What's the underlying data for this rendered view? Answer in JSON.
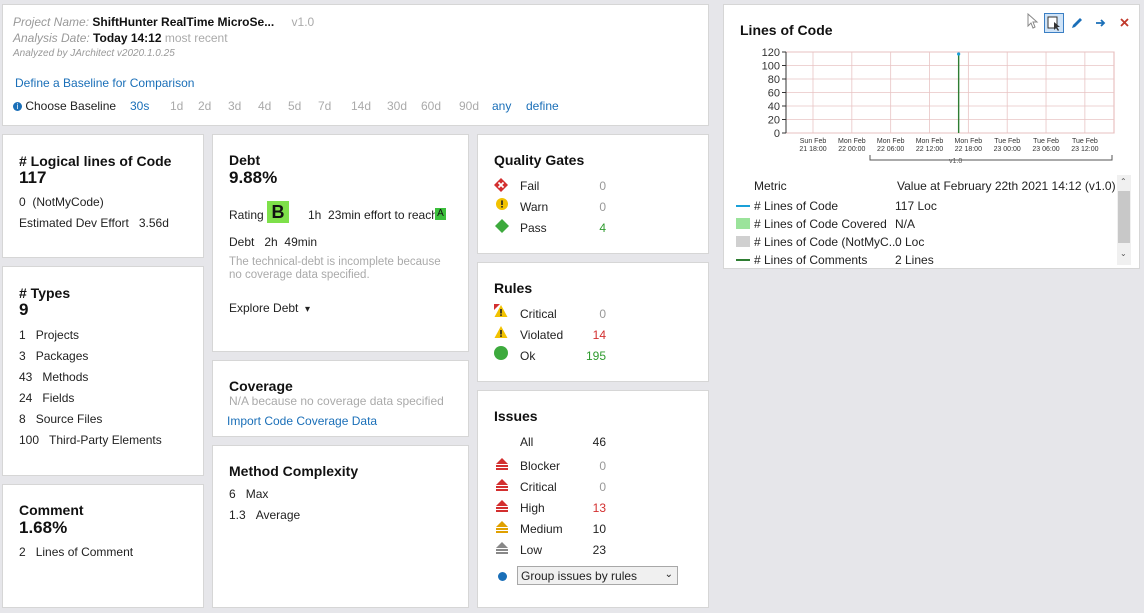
{
  "header": {
    "project_label": "Project Name:",
    "project_name": "ShiftHunter RealTime MicroSe...",
    "version": "v1.0",
    "analysis_label": "Analysis Date:",
    "analysis_date": "Today 14:12",
    "analysis_note": "most recent",
    "analyzed_by": "Analyzed by JArchitect v2020.1.0.25",
    "baseline_link": "Define a Baseline for Comparison",
    "choose_label": "Choose Baseline",
    "baseline_options": [
      "30s",
      "1d",
      "2d",
      "3d",
      "4d",
      "5d",
      "7d",
      "14d",
      "30d",
      "60d",
      "90d",
      "any",
      "define"
    ]
  },
  "loc": {
    "title": "# Logical lines of Code",
    "value": "117",
    "notmycode_num": "0",
    "notmycode_label": "(NotMyCode)",
    "effort_label": "Estimated Dev Effort",
    "effort_value": "3.56d"
  },
  "types": {
    "title": "# Types",
    "value": "9",
    "items": [
      {
        "n": "1",
        "label": "Projects"
      },
      {
        "n": "3",
        "label": "Packages"
      },
      {
        "n": "43",
        "label": "Methods"
      },
      {
        "n": "24",
        "label": "Fields"
      },
      {
        "n": "8",
        "label": "Source Files"
      },
      {
        "n": "100",
        "label": "Third-Party Elements"
      }
    ]
  },
  "comment": {
    "title": "Comment",
    "value": "1.68%",
    "lines_num": "2",
    "lines_label": "Lines of Comment"
  },
  "debt": {
    "title": "Debt",
    "value": "9.88%",
    "rating_label": "Rating",
    "rating": "B",
    "effort_h": "1h",
    "effort_rest": "23min effort to reach",
    "target": "A",
    "debt_label": "Debt",
    "debt_h": "2h",
    "debt_min": "49min",
    "note": "The technical-debt is incomplete because no coverage data specified.",
    "explore": "Explore Debt",
    "explore_caret": "▾",
    "rating_color": "#7ee04a",
    "target_color": "#3bbf3b"
  },
  "coverage": {
    "title": "Coverage",
    "note": "N/A because no coverage data specified",
    "import_link": "Import Code Coverage Data"
  },
  "complexity": {
    "title": "Method Complexity",
    "max_num": "6",
    "max_label": "Max",
    "avg_num": "1.3",
    "avg_label": "Average"
  },
  "quality_gates": {
    "title": "Quality Gates",
    "items": [
      {
        "label": "Fail",
        "value": "0",
        "icon": "fail-icon"
      },
      {
        "label": "Warn",
        "value": "0",
        "icon": "warn-icon"
      },
      {
        "label": "Pass",
        "value": "4",
        "icon": "pass-icon"
      }
    ]
  },
  "rules": {
    "title": "Rules",
    "items": [
      {
        "label": "Critical",
        "value": "0"
      },
      {
        "label": "Violated",
        "value": "14"
      },
      {
        "label": "Ok",
        "value": "195"
      }
    ]
  },
  "issues": {
    "title": "Issues",
    "all_label": "All",
    "all_value": "46",
    "items": [
      {
        "label": "Blocker",
        "value": "0"
      },
      {
        "label": "Critical",
        "value": "0"
      },
      {
        "label": "High",
        "value": "13"
      },
      {
        "label": "Medium",
        "value": "10"
      },
      {
        "label": "Low",
        "value": "23"
      }
    ],
    "group_select": "Group issues by rules"
  },
  "loc_chart_panel": {
    "title": "Lines of Code",
    "legend_header_metric": "Metric",
    "legend_header_value": "Value at February 22th 2021  14:12  (v1.0)",
    "legend": [
      {
        "label": "# Lines of Code",
        "value": "117 Loc",
        "color": "#1aa0d8"
      },
      {
        "label": "# Lines of Code Covered",
        "value": "N/A",
        "color": "#9be39b"
      },
      {
        "label": "# Lines of Code (NotMyC...",
        "value": "0 Loc",
        "color": "#d0d0d0"
      },
      {
        "label": "# Lines of Comments",
        "value": "2 Lines",
        "color": "#2e7d32"
      }
    ],
    "marker_label": "v1.0"
  },
  "chart_data": {
    "type": "line",
    "title": "Lines of Code",
    "yticks": [
      "120",
      "100",
      "80",
      "60",
      "40",
      "20",
      "0"
    ],
    "ylim": [
      0,
      120
    ],
    "xticks": [
      [
        "Sun Feb",
        "21 18:00"
      ],
      [
        "Mon Feb",
        "22 00:00"
      ],
      [
        "Mon Feb",
        "22 06:00"
      ],
      [
        "Mon Feb",
        "22 12:00"
      ],
      [
        "Mon Feb",
        "22 18:00"
      ],
      [
        "Tue Feb",
        "23 00:00"
      ],
      [
        "Tue Feb",
        "23 06:00"
      ],
      [
        "Tue Feb",
        "23 12:00"
      ]
    ],
    "series": [
      {
        "name": "# Lines of Code",
        "points": [
          [
            3.75,
            117
          ]
        ]
      }
    ],
    "grid": true
  }
}
